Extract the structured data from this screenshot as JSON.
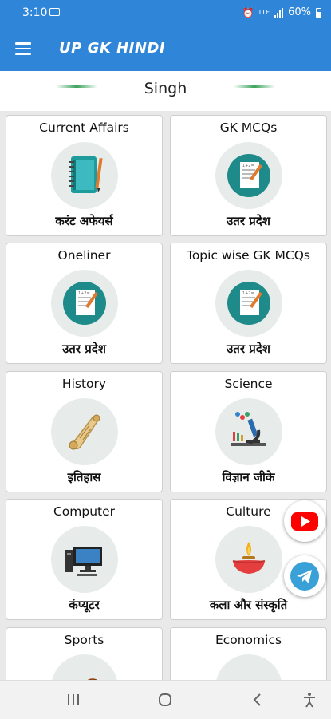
{
  "status": {
    "time": "3:10",
    "network_label": "LTE",
    "battery": "60%"
  },
  "app": {
    "title": "UP GK HINDI"
  },
  "user": {
    "name": "Singh"
  },
  "cards": [
    {
      "title": "Current Affairs",
      "subtitle": "करंट अफेयर्स",
      "icon": "notebook-icon"
    },
    {
      "title": "GK MCQs",
      "subtitle": "उतर प्रदेश",
      "icon": "document-icon"
    },
    {
      "title": "Oneliner",
      "subtitle": "उतर प्रदेश",
      "icon": "document-icon"
    },
    {
      "title": "Topic wise GK MCQs",
      "subtitle": "उतर प्रदेश",
      "icon": "document-icon"
    },
    {
      "title": "History",
      "subtitle": "इतिहास",
      "icon": "scroll-icon"
    },
    {
      "title": "Science",
      "subtitle": "विज्ञान जीके",
      "icon": "microscope-icon"
    },
    {
      "title": "Computer",
      "subtitle": "कंप्यूटर",
      "icon": "computer-icon"
    },
    {
      "title": "Culture",
      "subtitle": "कला और संस्कृति",
      "icon": "diya-lamp-icon"
    },
    {
      "title": "Sports",
      "subtitle": "",
      "icon": "sports-balls-icon"
    },
    {
      "title": "Economics",
      "subtitle": "",
      "icon": "economics-icon"
    }
  ],
  "floating": [
    "youtube-icon",
    "telegram-icon"
  ],
  "colors": {
    "primary": "#2f86d9",
    "youtube": "#ff0000",
    "telegram": "#3aa0d8"
  }
}
